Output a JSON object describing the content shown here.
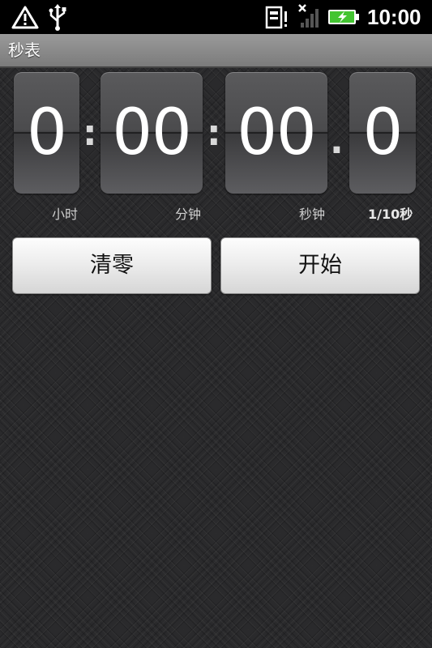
{
  "status_bar": {
    "time": "10:00",
    "icons": [
      "warning-icon",
      "usb-icon",
      "sd-card-alert-icon",
      "signal-no-service-icon",
      "battery-charging-icon"
    ],
    "colors": {
      "background": "#000000",
      "battery_fill": "#43c431"
    }
  },
  "app": {
    "title": "秒表"
  },
  "stopwatch": {
    "hours": "0",
    "minutes": "00",
    "seconds": "00",
    "tenths": "0",
    "separator_colon": ":",
    "separator_dot": ".",
    "labels": {
      "hours": "小时",
      "minutes": "分钟",
      "seconds": "秒钟",
      "tenths": "1/10秒"
    }
  },
  "buttons": {
    "reset_label": "清零",
    "start_label": "开始"
  }
}
